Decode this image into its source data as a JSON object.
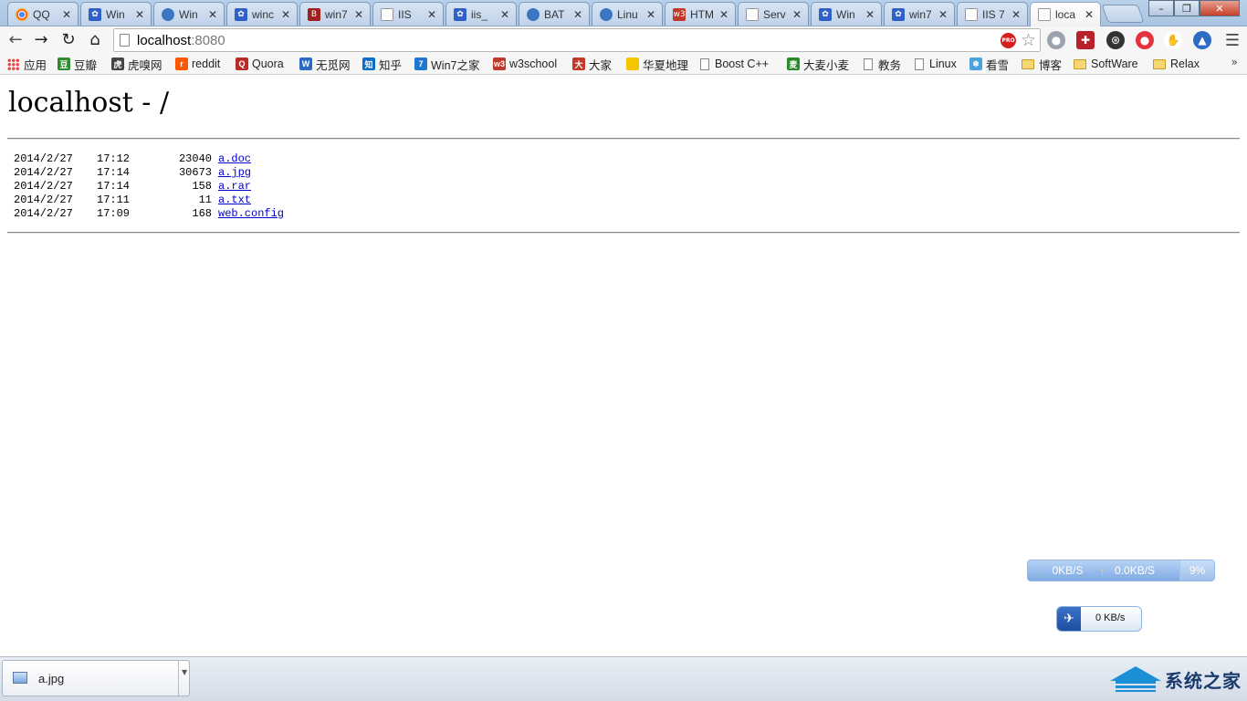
{
  "tabs": [
    {
      "title": "QQ",
      "icon": "chrome-icon",
      "left": 0
    },
    {
      "title": "Win",
      "icon": "paw-icon"
    },
    {
      "title": "Win",
      "icon": "globe-icon"
    },
    {
      "title": "winc",
      "icon": "paw-icon"
    },
    {
      "title": "win7",
      "icon": "b3-icon"
    },
    {
      "title": "IIS",
      "icon": "page-icon"
    },
    {
      "title": "iis_",
      "icon": "paw-icon"
    },
    {
      "title": "BAT",
      "icon": "globe-icon"
    },
    {
      "title": "Linu",
      "icon": "globe-icon"
    },
    {
      "title": "HTM",
      "icon": "w3-icon"
    },
    {
      "title": "Serv",
      "icon": "page-icon"
    },
    {
      "title": "Win",
      "icon": "paw-icon"
    },
    {
      "title": "win7",
      "icon": "paw-icon"
    },
    {
      "title": "IIS 7",
      "icon": "page-icon"
    },
    {
      "title": "loca",
      "icon": "page-icon",
      "active": true
    }
  ],
  "toolbar": {
    "url_host": "localhost",
    "url_port": ":8080",
    "pro_badge": "PRO"
  },
  "bookmarks": [
    {
      "label": "应用",
      "icon": "apps-grid-icon"
    },
    {
      "label": "豆瓣",
      "icon": "douban-icon"
    },
    {
      "label": "虎嗅网",
      "icon": "huxiu-icon"
    },
    {
      "label": "reddit",
      "icon": "reddit-icon"
    },
    {
      "label": "Quora",
      "icon": "quora-icon"
    },
    {
      "label": "无觅网",
      "icon": "wumi-icon"
    },
    {
      "label": "知乎",
      "icon": "zhihu-icon"
    },
    {
      "label": "Win7之家",
      "icon": "win7-icon"
    },
    {
      "label": "w3school",
      "icon": "w3school-icon"
    },
    {
      "label": "大家",
      "icon": "dajia-icon"
    },
    {
      "label": "华夏地理",
      "icon": "natgeo-icon"
    },
    {
      "label": "Boost C++",
      "icon": "page-icon"
    },
    {
      "label": "大麦小麦",
      "icon": "damai-icon"
    },
    {
      "label": "教务",
      "icon": "page-icon"
    },
    {
      "label": "Linux",
      "icon": "page-icon"
    },
    {
      "label": "看雪",
      "icon": "snowflake-icon"
    },
    {
      "label": "博客",
      "icon": "folder-icon"
    },
    {
      "label": "SoftWare",
      "icon": "folder-icon"
    },
    {
      "label": "Relax",
      "icon": "folder-icon"
    }
  ],
  "page": {
    "title": "localhost - /",
    "files": [
      {
        "date": "2014/2/27",
        "time": "17:12",
        "size": "23040",
        "name": "a.doc"
      },
      {
        "date": "2014/2/27",
        "time": "17:14",
        "size": "30673",
        "name": "a.jpg"
      },
      {
        "date": "2014/2/27",
        "time": "17:14",
        "size": "158",
        "name": "a.rar"
      },
      {
        "date": "2014/2/27",
        "time": "17:11",
        "size": "11",
        "name": "a.txt"
      },
      {
        "date": "2014/2/27",
        "time": "17:09",
        "size": "168",
        "name": "web.config"
      }
    ]
  },
  "netspeed": {
    "down": "0KB/S",
    "up": "0.0KB/S",
    "percent": "9%"
  },
  "bird_widget": {
    "value": "0 KB/s"
  },
  "download": {
    "filename": "a.jpg"
  },
  "watermark": {
    "text": "系统之家"
  },
  "colors": {
    "link": "#0000cc",
    "tabstrip": "#b9d1ea"
  }
}
